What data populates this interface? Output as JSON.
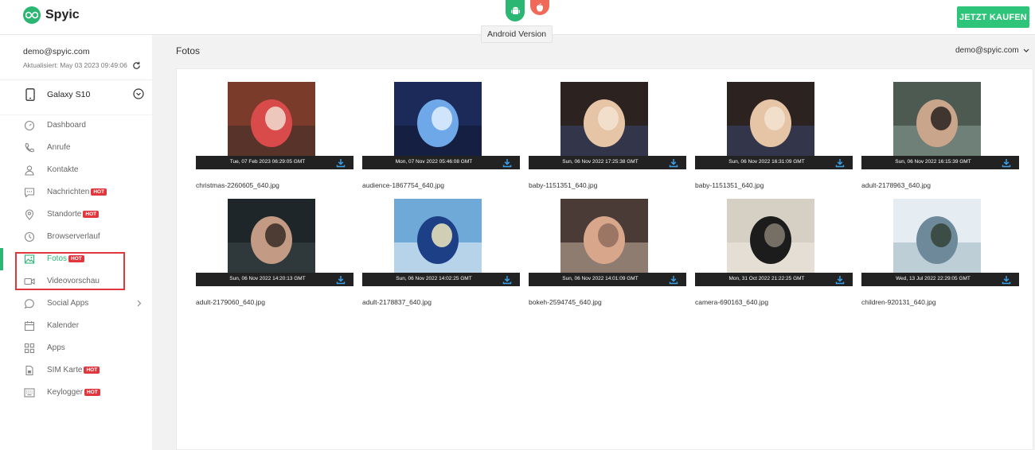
{
  "header": {
    "brand": "Spyic",
    "tooltip": "Android Version",
    "buy_label": "JETZT KAUFEN",
    "os_icons": [
      "android-icon",
      "apple-icon"
    ]
  },
  "account": {
    "email": "demo@spyic.com",
    "updated": "Aktualisiert: May 03 2023 09:49:06"
  },
  "device": {
    "name": "Galaxy S10"
  },
  "nav": [
    {
      "label": "Dashboard",
      "hot": "",
      "icon": "dashboard-icon"
    },
    {
      "label": "Anrufe",
      "hot": "",
      "icon": "phone-icon"
    },
    {
      "label": "Kontakte",
      "hot": "",
      "icon": "contacts-icon"
    },
    {
      "label": "Nachrichten",
      "hot": "HOT",
      "icon": "message-icon"
    },
    {
      "label": "Standorte",
      "hot": "HOT",
      "icon": "location-icon"
    },
    {
      "label": "Browserverlauf",
      "hot": "",
      "icon": "history-icon"
    },
    {
      "label": "Fotos",
      "hot": "HOT",
      "icon": "image-icon"
    },
    {
      "label": "Videovorschau",
      "hot": "",
      "icon": "video-icon"
    },
    {
      "label": "Social Apps",
      "hot": "",
      "icon": "chat-icon"
    },
    {
      "label": "Kalender",
      "hot": "",
      "icon": "calendar-icon"
    },
    {
      "label": "Apps",
      "hot": "",
      "icon": "apps-icon"
    },
    {
      "label": "SIM Karte",
      "hot": "HOT",
      "icon": "sim-icon"
    },
    {
      "label": "Keylogger",
      "hot": "HOT",
      "icon": "keyboard-icon"
    }
  ],
  "main": {
    "title": "Fotos",
    "user_menu": "demo@spyic.com"
  },
  "photos": [
    {
      "date": "Tue, 07 Feb 2023 06:29:05 GMT",
      "file": "christmas-2260605_640.jpg",
      "palette": [
        "#7a3b2a",
        "#d94a4a",
        "#f2e6d8",
        "#3b2e2a"
      ]
    },
    {
      "date": "Mon, 07 Nov 2022 05:46:08 GMT",
      "file": "audience-1867754_640.jpg",
      "palette": [
        "#1c2a5a",
        "#6fa8e8",
        "#e8f2ff",
        "#10162e"
      ]
    },
    {
      "date": "Sun, 06 Nov 2022 17:25:38 GMT",
      "file": "baby-1151351_640.jpg",
      "palette": [
        "#2c2220",
        "#e6c4a6",
        "#f4e6d6",
        "#3a4770"
      ]
    },
    {
      "date": "Sun, 06 Nov 2022 16:31:09 GMT",
      "file": "baby-1151351_640.jpg",
      "palette": [
        "#2c2220",
        "#e6c4a6",
        "#f4e6d6",
        "#3a4770"
      ]
    },
    {
      "date": "Sun, 06 Nov 2022 16:15:39 GMT",
      "file": "adult-2178963_640.jpg",
      "palette": [
        "#4c5a52",
        "#c9a58c",
        "#1e1a18",
        "#8aa095"
      ]
    },
    {
      "date": "Sun, 06 Nov 2022 14:20:13 GMT",
      "file": "adult-2179060_640.jpg",
      "palette": [
        "#1f2629",
        "#c39a83",
        "#2e2420",
        "#3d474a"
      ]
    },
    {
      "date": "Sun, 06 Nov 2022 14:02:25 GMT",
      "file": "adult-2178837_640.jpg",
      "palette": [
        "#6fa9d8",
        "#1d3f86",
        "#fff2c2",
        "#f2f6fa"
      ]
    },
    {
      "date": "Sun, 06 Nov 2022 14:01:09 GMT",
      "file": "bokeh-2594745_640.jpg",
      "palette": [
        "#4a3b36",
        "#d8a68a",
        "#8c6a5a",
        "#c9b3a0"
      ]
    },
    {
      "date": "Mon, 31 Oct 2022 21:22:25 GMT",
      "file": "camera-690163_640.jpg",
      "palette": [
        "#d6cfc4",
        "#1c1c1c",
        "#8c8479",
        "#f0ebe2"
      ]
    },
    {
      "date": "Wed, 13 Jul 2022 22:29:05 GMT",
      "file": "children-920131_640.jpg",
      "palette": [
        "#e6edf2",
        "#6e8a9a",
        "#2f3d2f",
        "#9db4c0"
      ]
    }
  ]
}
